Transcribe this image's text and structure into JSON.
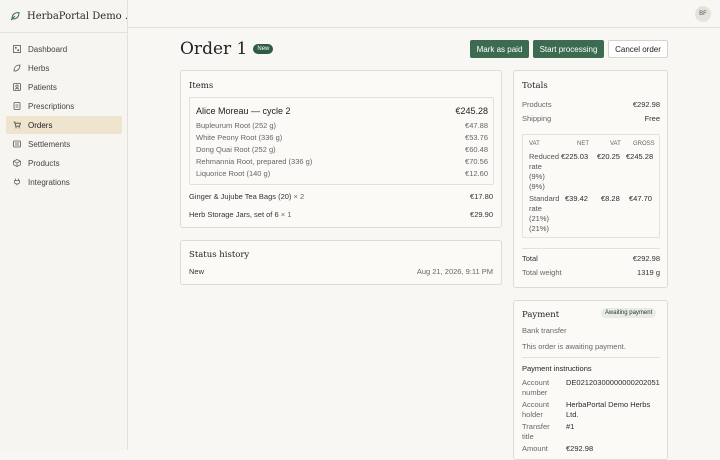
{
  "brand": {
    "name": "HerbaPortal Demo ..."
  },
  "user": {
    "initials": "BF"
  },
  "nav": [
    {
      "label": "Dashboard",
      "icon": "dashboard-icon"
    },
    {
      "label": "Herbs",
      "icon": "leaf-icon"
    },
    {
      "label": "Patients",
      "icon": "patient-icon"
    },
    {
      "label": "Prescriptions",
      "icon": "prescription-icon"
    },
    {
      "label": "Orders",
      "icon": "cart-icon",
      "active": true
    },
    {
      "label": "Settlements",
      "icon": "settlements-icon"
    },
    {
      "label": "Products",
      "icon": "box-icon"
    },
    {
      "label": "Integrations",
      "icon": "plug-icon"
    }
  ],
  "order": {
    "title": "Order 1",
    "status": "New"
  },
  "actions": {
    "mark_paid": "Mark as paid",
    "start_processing": "Start processing",
    "cancel": "Cancel order"
  },
  "items": {
    "title": "Items",
    "prescription": {
      "name": "Alice Moreau — cycle 2",
      "total": "€245.28",
      "herbs": [
        {
          "name": "Bupleurum Root (252 g)",
          "price": "€47.88"
        },
        {
          "name": "White Peony Root (336 g)",
          "price": "€53.76"
        },
        {
          "name": "Dong Quai Root (252 g)",
          "price": "€60.48"
        },
        {
          "name": "Rehmannia Root, prepared (336 g)",
          "price": "€70.56"
        },
        {
          "name": "Liquorice Root (140 g)",
          "price": "€12.60"
        }
      ]
    },
    "products": [
      {
        "name": "Ginger & Jujube Tea Bags (20)",
        "qty": "× 2",
        "price": "€17.80"
      },
      {
        "name": "Herb Storage Jars, set of 6",
        "qty": "× 1",
        "price": "€29.90"
      }
    ]
  },
  "status_history": {
    "title": "Status history",
    "entries": [
      {
        "status": "New",
        "date": "Aug 21, 2026, 9:11 PM"
      }
    ]
  },
  "totals": {
    "title": "Totals",
    "products_label": "Products",
    "products_value": "€292.98",
    "shipping_label": "Shipping",
    "shipping_value": "Free",
    "vat_table": {
      "headers": [
        "VAT",
        "NET",
        "VAT",
        "GROSS"
      ],
      "rows": [
        {
          "label": [
            "Reduced",
            "rate",
            "(9%)",
            "(9%)"
          ],
          "net": "€225.03",
          "vat": "€20.25",
          "gross": "€245.28"
        },
        {
          "label": [
            "Standard",
            "rate",
            "(21%)",
            "(21%)"
          ],
          "net": "€39.42",
          "vat": "€8.28",
          "gross": "€47.70"
        }
      ]
    },
    "total_label": "Total",
    "total_value": "€292.98",
    "weight_label": "Total weight",
    "weight_value": "1319 g"
  },
  "payment": {
    "title": "Payment",
    "badge": "Awaiting payment",
    "method": "Bank transfer",
    "message": "This order is awaiting payment.",
    "instructions_title": "Payment instructions",
    "fields": [
      {
        "label": [
          "Account",
          "number"
        ],
        "value": [
          "DE02120300000000202051"
        ]
      },
      {
        "label": [
          "Account",
          "holder"
        ],
        "value": [
          "HerbaPortal Demo Herbs",
          "Ltd."
        ]
      },
      {
        "label": [
          "Transfer",
          "title"
        ],
        "value": [
          "#1"
        ]
      },
      {
        "label": [
          "Amount"
        ],
        "value": [
          "€292.98"
        ]
      }
    ]
  }
}
